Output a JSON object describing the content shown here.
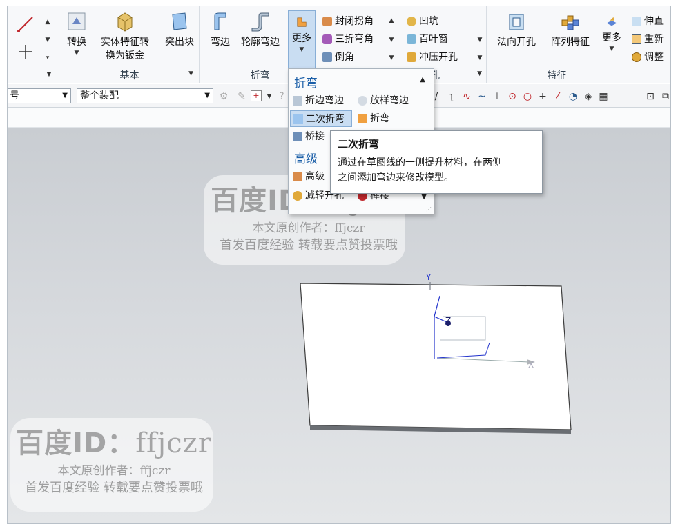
{
  "ribbon": {
    "basic_group": {
      "label": "基本",
      "buttons": [
        {
          "label": "转换"
        },
        {
          "label": "实体特征转",
          "label2": "换为钣金"
        },
        {
          "label": "突出块"
        }
      ]
    },
    "bend_group": {
      "label": "折弯",
      "buttons": [
        {
          "label": "弯边"
        },
        {
          "label": "轮廓弯边"
        },
        {
          "label": "更多"
        }
      ]
    },
    "corner_items": [
      {
        "label": "封闭拐角"
      },
      {
        "label": "三折弯角"
      },
      {
        "label": "倒角"
      }
    ],
    "punch_items": [
      {
        "label": "凹坑"
      },
      {
        "label": "百叶窗"
      },
      {
        "label": "冲压开孔"
      }
    ],
    "punch_group_label": "孔",
    "feature_group": {
      "label": "特征",
      "buttons": [
        {
          "label": "法向开孔"
        },
        {
          "label": "阵列特征"
        },
        {
          "label": "更多"
        }
      ]
    },
    "right_items": [
      {
        "label": "伸直"
      },
      {
        "label": "重新"
      },
      {
        "label": "调整"
      }
    ]
  },
  "toolbar": {
    "combo1_value": "",
    "combo1_partial": "号",
    "combo2_value": "整个装配"
  },
  "menu": {
    "section1": "折弯",
    "items1": [
      {
        "label": "折边弯边"
      },
      {
        "label": "放样弯边"
      },
      {
        "label": "二次折弯"
      },
      {
        "label": "折弯"
      },
      {
        "label": "桥接"
      }
    ],
    "section2": "高级",
    "items2": [
      {
        "label": "高级"
      },
      {
        "label": "减轻开孔"
      },
      {
        "label": "榫接"
      }
    ]
  },
  "tooltip": {
    "title": "二次折弯",
    "line1": "通过在草图线的一侧提升材料，在两侧",
    "line2": "之间添加弯边来修改模型。"
  },
  "axes": {
    "x": "X",
    "y": "Y",
    "z": "Z"
  },
  "watermark": {
    "id_label": "百度ID：",
    "id_value": "ffjczr",
    "line1": "本文原创作者：ffjczr",
    "line2": "首发百度经验 转载要点赞投票哦"
  },
  "colors": {
    "accent": "#1b5fa8",
    "menu_selected": "#c9ddf2",
    "axis": "#2233cc"
  }
}
